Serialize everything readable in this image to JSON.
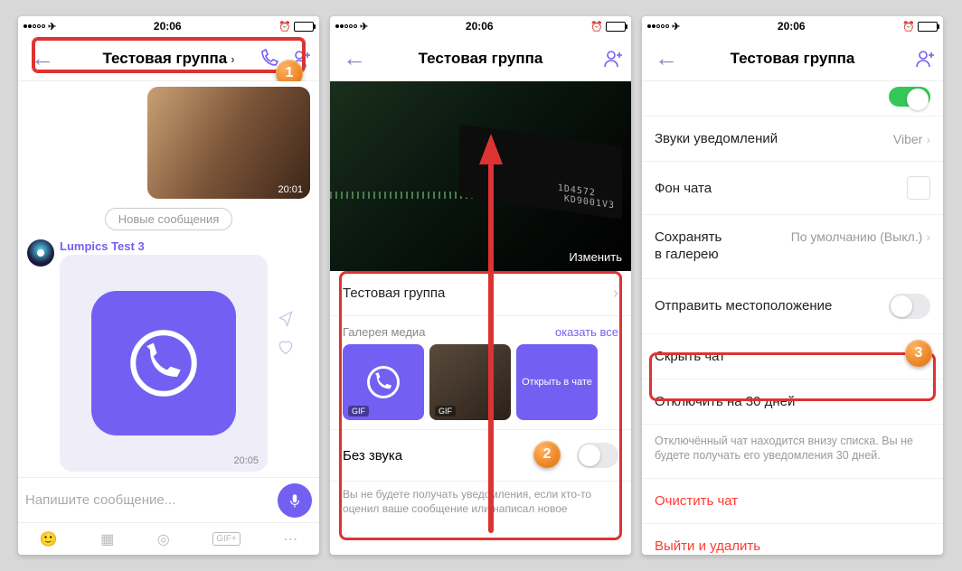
{
  "status": {
    "time": "20:06"
  },
  "colors": {
    "accent": "#7360f2",
    "danger": "#ff3b30",
    "highlight": "#d33"
  },
  "phone1": {
    "title": "Тестовая группа",
    "img_ts": "20:01",
    "new_messages": "Новые сообщения",
    "sender": "Lumpics Test 3",
    "bubble_ts": "20:05",
    "composer_placeholder": "Напишите сообщение...",
    "step": "1"
  },
  "phone2": {
    "title": "Тестовая группа",
    "cover_edit": "Изменить",
    "group_name_row": "Тестовая группа",
    "gallery_label": "Галерея медиа",
    "show_all": "оказать все",
    "thumb_gif": "GIF",
    "thumb_card": "Открыть в чате",
    "mute_label": "Без звука",
    "mute_note": "Вы не будете получать уведомления, если кто-то оценил ваше сообщение или написал новое",
    "step": "2"
  },
  "phone3": {
    "title": "Тестовая группа",
    "rows": {
      "sounds_label": "Звуки уведомлений",
      "sounds_value": "Viber",
      "bg_label": "Фон чата",
      "save_label_l1": "Сохранять",
      "save_label_l2": "в галерею",
      "save_value": "По умолчанию (Выкл.)",
      "location_label": "Отправить местоположение",
      "hide_label": "Скрыть чат",
      "snooze_label": "Отключить на 30 дней",
      "snooze_note": "Отключённый чат находится внизу списка. Вы не будете получать его уведомления 30 дней.",
      "clear_label": "Очистить чат",
      "leave_label": "Выйти и удалить"
    },
    "step": "3"
  }
}
